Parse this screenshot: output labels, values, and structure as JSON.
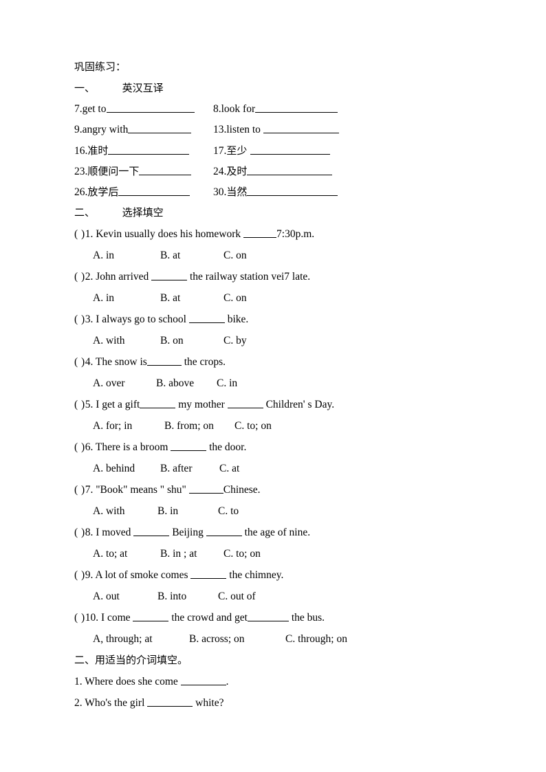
{
  "document": {
    "heading": "巩固练习：",
    "section1": {
      "number": "一、",
      "title": "英汉互译",
      "items": [
        {
          "left_num": "7.",
          "left_text": "get to",
          "left_blank": 128,
          "right_num": "8.",
          "right_text": "look for",
          "right_blank": 120
        },
        {
          "left_num": "9.",
          "left_text": "angry with",
          "left_blank": 92,
          "right_num": "13.",
          "right_text": "listen  to ",
          "right_blank": 110
        },
        {
          "left_num": "16.",
          "left_text": "准时",
          "left_blank": 118,
          "right_num": "17.",
          "right_text": "至少 ",
          "right_blank": 116
        },
        {
          "left_num": "23.",
          "left_text": "顺便问一下",
          "left_blank": 76,
          "right_num": "24.",
          "right_text": "及时",
          "right_blank": 124
        },
        {
          "left_num": "26.",
          "left_text": "放学后",
          "left_blank": 104,
          "right_num": "30.",
          "right_text": "当然",
          "right_blank": 132
        }
      ]
    },
    "section2": {
      "number": "二、",
      "title": "选择填空",
      "questions": [
        {
          "marker": "(    )",
          "number": "1.",
          "text_before": " Kevin usually  does his homework ",
          "blank": 48,
          "text_after": "7:30p.m.",
          "options": [
            "A. in",
            "B. at",
            "C. on"
          ],
          "option_x": [
            0,
            98,
            190
          ]
        },
        {
          "marker": "(    )",
          "number": "2.",
          "text_before": " John arrived ",
          "blank": 52,
          "text_after": " the railway  station  vei7 late.",
          "options": [
            "A. in",
            "B. at",
            "C. on"
          ],
          "option_x": [
            0,
            98,
            190
          ]
        },
        {
          "marker": "(    )",
          "number": "3.",
          "text_before": " I always go to school ",
          "blank": 52,
          "text_after": " bike.",
          "options": [
            "A. with",
            "B. on",
            "C. by"
          ],
          "option_x": [
            0,
            98,
            190
          ]
        },
        {
          "marker": "(    )",
          "number": "4.",
          "text_before": " The snow is",
          "blank": 50,
          "text_after": " the crops.",
          "options": [
            "A. over",
            "B. above",
            "C. in"
          ],
          "option_x": [
            0,
            92,
            180
          ]
        },
        {
          "marker": "(    )",
          "number": "5.",
          "text_before": " I get a gift",
          "blank": 52,
          "text_mid": " my mother ",
          "blank2": 52,
          "text_after": " Children' s Day.",
          "options": [
            "A. for; in",
            "B. from; on",
            "C. to; on"
          ],
          "option_x": [
            0,
            104,
            206
          ]
        },
        {
          "marker": "(    )",
          "number": "6.",
          "text_before": " There is a broom ",
          "blank": 52,
          "text_after": " the door.",
          "options": [
            "A. behind",
            "B. after",
            "C. at"
          ],
          "option_x": [
            0,
            98,
            184
          ]
        },
        {
          "marker": "(    )",
          "number": "7.",
          "text_before": " \"Book\" means \" shu\" ",
          "blank": 50,
          "text_after": "Chinese.",
          "options": [
            "A. with",
            "B. in",
            "C. to"
          ],
          "option_x": [
            0,
            94,
            182
          ]
        },
        {
          "marker": "(    )",
          "number": "8.",
          "text_before": " I moved ",
          "blank": 52,
          "text_mid": " Beijing ",
          "blank2": 52,
          "text_after": " the age of nine.",
          "options": [
            "A. to; at",
            "B. in ; at",
            "C. to; on"
          ],
          "option_x": [
            0,
            98,
            190
          ]
        },
        {
          "marker": "(    )",
          "number": "9.",
          "text_before": " A lot of smoke comes ",
          "blank": 52,
          "text_after": " the chimney.",
          "options": [
            "A. out",
            "B. into",
            "C. out of"
          ],
          "option_x": [
            0,
            94,
            182
          ]
        },
        {
          "marker": "(    )",
          "number": "10.",
          "text_before": " I come ",
          "blank": 52,
          "text_mid": " the crowd and get",
          "blank2": 60,
          "text_after": " the bus.",
          "options": [
            "A, through; at",
            "B. across;  on",
            "C. through; on"
          ],
          "option_x": [
            0,
            140,
            280
          ]
        }
      ]
    },
    "section3": {
      "title": "二、用适当的介词填空。",
      "items": [
        {
          "number": "1.",
          "text_before": " Where does she come ",
          "blank": 66,
          "text_after": "."
        },
        {
          "number": "2.",
          "text_before": " Who's the girl    ",
          "blank": 66,
          "text_after": " white?"
        }
      ]
    }
  }
}
